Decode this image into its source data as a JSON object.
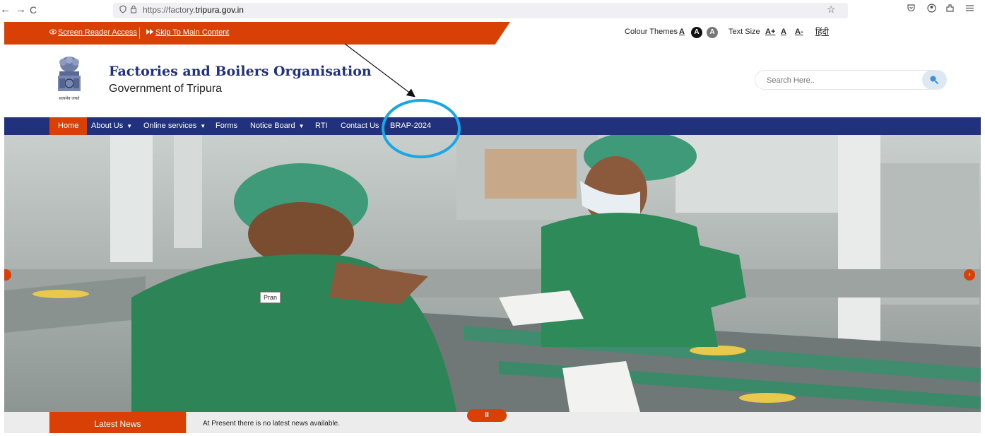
{
  "browser": {
    "back": "←",
    "forward": "→",
    "reload": "C",
    "url_prefix": "https://factory.",
    "url_domain": "tripura.gov.in"
  },
  "topbar": {
    "screen_reader": "Screen Reader Access",
    "skip_main": "Skip To Main Content",
    "colour_themes_label": "Colour Themes",
    "theme_a": "A",
    "text_size_label": "Text Size",
    "size_plus": "A+",
    "size_normal": "A",
    "size_minus": "A-",
    "hindi": "हिंदी"
  },
  "header": {
    "emblem_caption": "सत्यमेव जयते",
    "title": "Factories and Boilers Organisation",
    "subtitle": "Government of Tripura"
  },
  "search": {
    "placeholder": "Search Here.."
  },
  "nav": {
    "items": [
      "Home",
      "About Us",
      "Online services",
      "Forms",
      "Notice Board",
      "RTI",
      "Contact Us",
      "BRAP-2024"
    ]
  },
  "hero": {
    "tooltip": "Pran"
  },
  "news": {
    "label": "Latest News",
    "text": "At Present there is no latest news available.",
    "pause": "II"
  },
  "colors": {
    "accent_orange": "#d94006",
    "nav_blue": "#21317d",
    "annotation_circle": "#1aa7e6"
  }
}
